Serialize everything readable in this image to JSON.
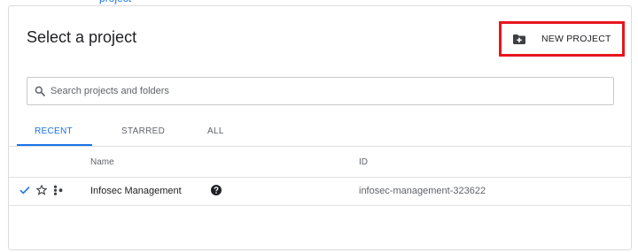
{
  "background_hint": {
    "partial_text": "project"
  },
  "dialog": {
    "title": "Select a project",
    "new_project_label": "NEW PROJECT",
    "new_project_icon": "add-folder-icon",
    "highlight_color": "#e8151d"
  },
  "search": {
    "placeholder": "Search projects and folders",
    "value": ""
  },
  "tabs": [
    {
      "label": "RECENT",
      "active": true
    },
    {
      "label": "STARRED",
      "active": false
    },
    {
      "label": "ALL",
      "active": false
    }
  ],
  "table": {
    "columns": {
      "name": "Name",
      "id": "ID"
    },
    "rows": [
      {
        "selected": true,
        "starred": false,
        "name": "Infosec Management",
        "id": "infosec-management-323622"
      }
    ]
  },
  "colors": {
    "accent": "#1a73e8",
    "text": "#202124",
    "muted": "#5f6368",
    "border": "#dadce0"
  }
}
